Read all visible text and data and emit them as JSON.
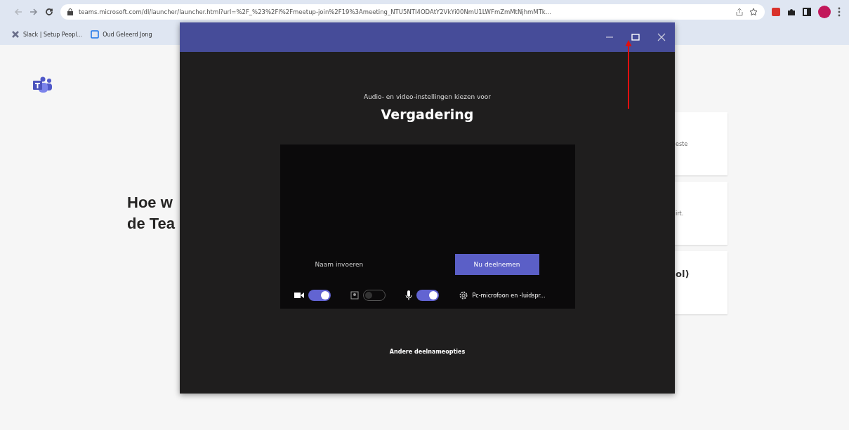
{
  "browser": {
    "address": "teams.microsoft.com/dl/launcher/launcher.html?url=%2F_%23%2Fl%2Fmeetup-join%2F19%3Ameeting_NTU5NTI4ODAtY2VkYi00NmU1LWFmZmMtNjhmMTk...",
    "bookmarks": [
      "Slack | Setup Peopl...",
      "Oud Geleerd Jong"
    ]
  },
  "page": {
    "heading_lines": [
      "Hoe w",
      "de Tea"
    ],
    "cards": [
      {
        "kind": "desc",
        "text": "este"
      },
      {
        "kind": "desc",
        "text": "irt."
      },
      {
        "kind": "title",
        "text": "ol)"
      }
    ]
  },
  "dialog": {
    "subtitle": "Audio- en video-instellingen kiezen voor",
    "title": "Vergadering",
    "name_field": {
      "placeholder": "Naam invoeren"
    },
    "join_button": "Nu deelnemen",
    "controls": [
      {
        "kind": "camera",
        "on": true
      },
      {
        "kind": "blur",
        "on": false
      },
      {
        "kind": "mic",
        "on": true
      }
    ],
    "device": "Pc-microfoon en -luidspr...",
    "other_options": "Andere deelnameopties"
  }
}
